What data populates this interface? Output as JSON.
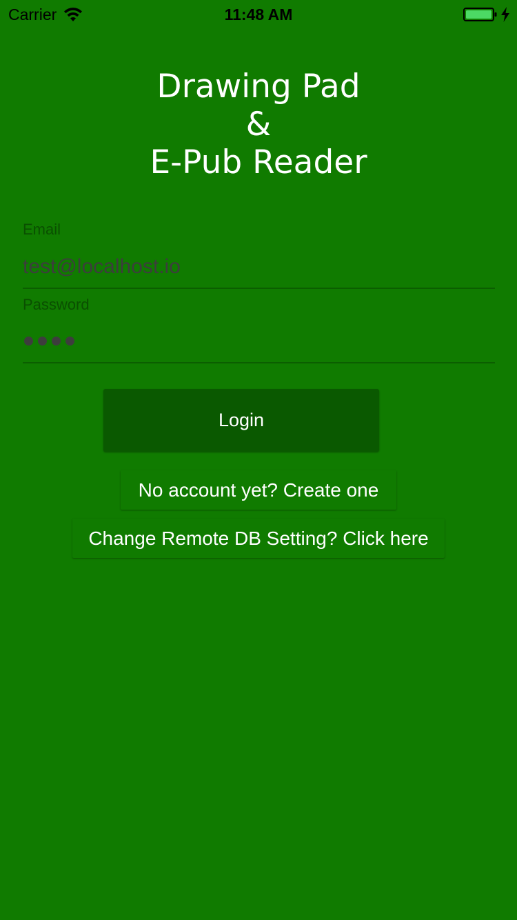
{
  "status_bar": {
    "carrier": "Carrier",
    "time": "11:48 AM",
    "wifi_icon": "wifi-icon",
    "battery_icon": "battery-icon",
    "charging_icon": "bolt-icon",
    "battery_color": "#4cd964"
  },
  "title": {
    "line1": "Drawing Pad",
    "line2": "&",
    "line3": "E-Pub Reader"
  },
  "form": {
    "email_label": "Email",
    "email_value": "test@localhost.io",
    "password_label": "Password",
    "password_length": 4
  },
  "buttons": {
    "login": "Login",
    "create_account": "No account yet? Create one",
    "remote_db": "Change Remote DB Setting? Click here"
  },
  "colors": {
    "background": "#107b00",
    "login_button": "#0a5900",
    "text": "#ffffff"
  }
}
